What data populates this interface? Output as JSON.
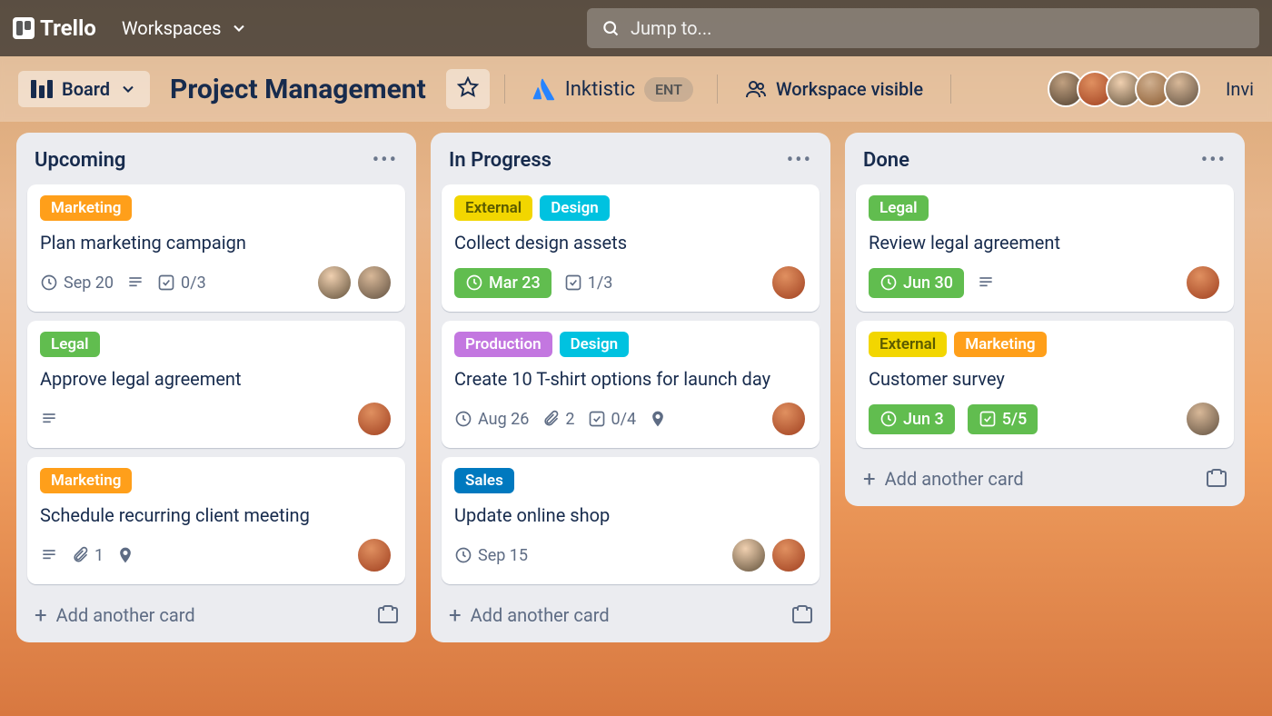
{
  "nav": {
    "brand": "Trello",
    "workspaces_label": "Workspaces",
    "search_placeholder": "Jump to..."
  },
  "board_header": {
    "view_label": "Board",
    "title": "Project Management",
    "org_name": "Inktistic",
    "org_badge": "ENT",
    "visibility": "Workspace visible",
    "invite_label": "Invi"
  },
  "lists": [
    {
      "title": "Upcoming",
      "cards": [
        {
          "labels": [
            {
              "text": "Marketing",
              "cls": "lbl-orange"
            }
          ],
          "title": "Plan marketing campaign",
          "date": "Sep 20",
          "date_green": false,
          "has_desc": true,
          "checklist": "0/3",
          "checklist_green": false,
          "attachments": null,
          "location": false,
          "avatars": [
            "a1",
            "a5"
          ]
        },
        {
          "labels": [
            {
              "text": "Legal",
              "cls": "lbl-green"
            }
          ],
          "title": "Approve legal agreement",
          "date": null,
          "has_desc": true,
          "checklist": null,
          "attachments": null,
          "location": false,
          "avatars": [
            "a3"
          ]
        },
        {
          "labels": [
            {
              "text": "Marketing",
              "cls": "lbl-orange"
            }
          ],
          "title": "Schedule recurring client meeting",
          "date": null,
          "has_desc": true,
          "checklist": null,
          "attachments": "1",
          "location": true,
          "avatars": [
            "a3"
          ]
        }
      ],
      "add_label": "Add another card"
    },
    {
      "title": "In Progress",
      "cards": [
        {
          "labels": [
            {
              "text": "External",
              "cls": "lbl-yellow"
            },
            {
              "text": "Design",
              "cls": "lbl-teal"
            }
          ],
          "title": "Collect design assets",
          "date": "Mar 23",
          "date_green": true,
          "has_desc": false,
          "checklist": "1/3",
          "checklist_green": false,
          "attachments": null,
          "location": false,
          "avatars": [
            "a3"
          ]
        },
        {
          "labels": [
            {
              "text": "Production",
              "cls": "lbl-purple"
            },
            {
              "text": "Design",
              "cls": "lbl-teal"
            }
          ],
          "title": "Create 10 T-shirt options for launch day",
          "date": "Aug 26",
          "date_green": false,
          "has_desc": false,
          "checklist": "0/4",
          "checklist_green": false,
          "attachments": "2",
          "location": true,
          "avatars": [
            "a3"
          ]
        },
        {
          "labels": [
            {
              "text": "Sales",
              "cls": "lbl-blue"
            }
          ],
          "title": "Update online shop",
          "date": "Sep 15",
          "date_green": false,
          "has_desc": false,
          "checklist": null,
          "attachments": null,
          "location": false,
          "avatars": [
            "a1",
            "a3"
          ]
        }
      ],
      "add_label": "Add another card"
    },
    {
      "title": "Done",
      "cards": [
        {
          "labels": [
            {
              "text": "Legal",
              "cls": "lbl-green"
            }
          ],
          "title": "Review legal agreement",
          "date": "Jun 30",
          "date_green": true,
          "has_desc": true,
          "checklist": null,
          "attachments": null,
          "location": false,
          "avatars": [
            "a3"
          ]
        },
        {
          "labels": [
            {
              "text": "External",
              "cls": "lbl-yellow"
            },
            {
              "text": "Marketing",
              "cls": "lbl-orange"
            }
          ],
          "title": "Customer survey",
          "date": "Jun 3",
          "date_green": true,
          "has_desc": false,
          "checklist": "5/5",
          "checklist_green": true,
          "attachments": null,
          "location": false,
          "avatars": [
            "a5"
          ]
        }
      ],
      "add_label": "Add another card"
    }
  ]
}
